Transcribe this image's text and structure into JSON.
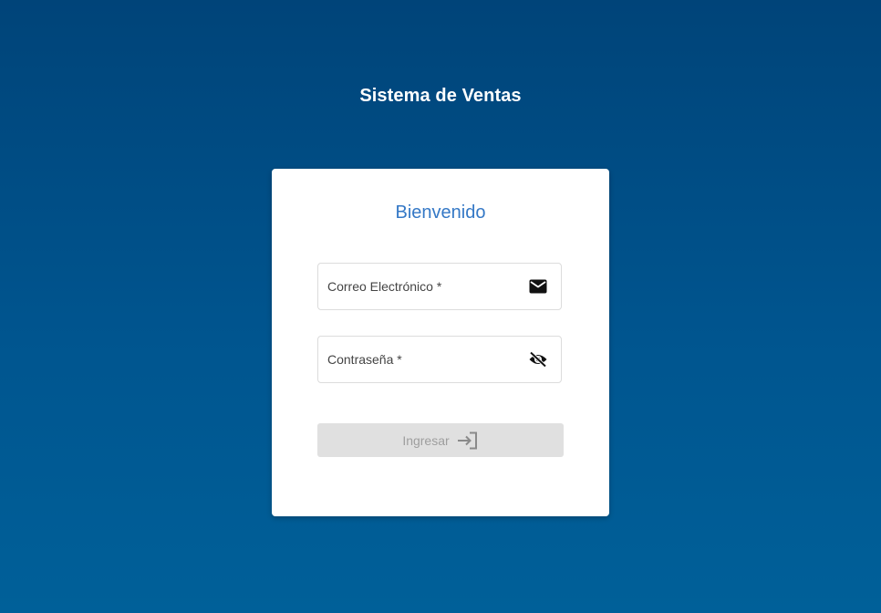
{
  "app": {
    "title": "Sistema de Ventas"
  },
  "login_card": {
    "heading": "Bienvenido",
    "email_field": {
      "placeholder": "Correo Electrónico *",
      "value": "",
      "icon": "mail-icon"
    },
    "password_field": {
      "placeholder": "Contraseña *",
      "value": "",
      "icon": "eye-off-icon"
    },
    "submit": {
      "label": "Ingresar",
      "icon": "login-icon",
      "enabled": false
    }
  },
  "colors": {
    "background_top": "#004479",
    "background_bottom": "#006099",
    "heading": "#3478c6",
    "button_disabled_bg": "#e0e0e0",
    "button_disabled_text": "#9e9e9e"
  }
}
